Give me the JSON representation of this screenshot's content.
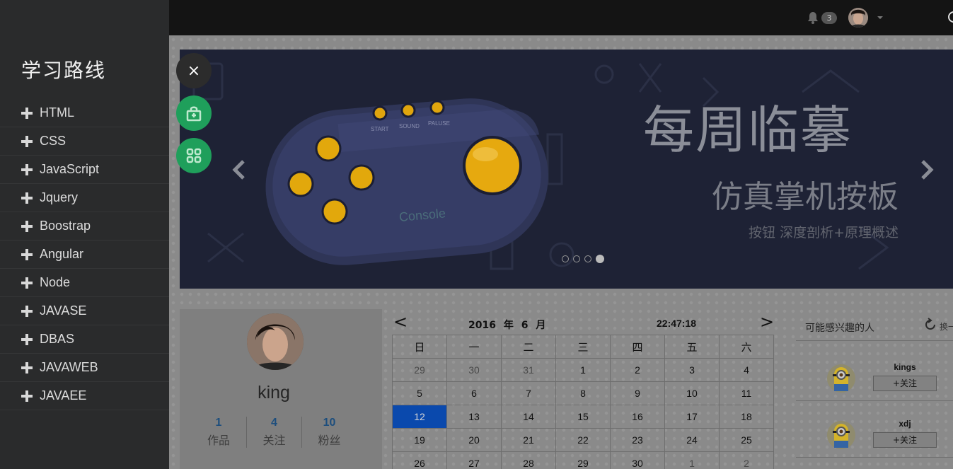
{
  "header": {
    "notification_count": "3",
    "icons": [
      "bell-icon",
      "avatar",
      "chevron-down-icon"
    ]
  },
  "sidebar": {
    "title": "学习路线",
    "items": [
      {
        "label": "HTML"
      },
      {
        "label": "CSS"
      },
      {
        "label": "JavaScript"
      },
      {
        "label": "Jquery"
      },
      {
        "label": "Boostrap"
      },
      {
        "label": "Angular"
      },
      {
        "label": "Node"
      },
      {
        "label": "JAVASE"
      },
      {
        "label": "DBAS"
      },
      {
        "label": "JAVAWEB"
      },
      {
        "label": "JAVAEE"
      }
    ]
  },
  "floating": {
    "close_symbol": "×",
    "icons": [
      "close-icon",
      "lock-icon",
      "grid-icon"
    ]
  },
  "banner": {
    "title": "每周临摹",
    "subtitle": "仿真掌机按板",
    "description": "按钮 深度剖析+原理概述",
    "console_label": "Console",
    "small_buttons": [
      "START",
      "SOUND",
      "PALUSE"
    ],
    "slides": 4,
    "active_slide": 4
  },
  "profile": {
    "name": "king",
    "stats": [
      {
        "num": "1",
        "label": "作品"
      },
      {
        "num": "4",
        "label": "关注"
      },
      {
        "num": "10",
        "label": "粉丝"
      }
    ]
  },
  "calendar": {
    "prev": "<",
    "next": ">",
    "year_month": "2016 年 6 月",
    "time": "22:47:18",
    "weekdays": [
      "日",
      "一",
      "二",
      "三",
      "四",
      "五",
      "六"
    ],
    "weeks": [
      [
        [
          "29",
          "muted"
        ],
        [
          "30",
          "muted"
        ],
        [
          "31",
          "muted"
        ],
        [
          "1",
          ""
        ],
        [
          "2",
          ""
        ],
        [
          "3",
          ""
        ],
        [
          "4",
          ""
        ]
      ],
      [
        [
          "5",
          ""
        ],
        [
          "6",
          ""
        ],
        [
          "7",
          ""
        ],
        [
          "8",
          ""
        ],
        [
          "9",
          ""
        ],
        [
          "10",
          ""
        ],
        [
          "11",
          ""
        ]
      ],
      [
        [
          "12",
          "today"
        ],
        [
          "13",
          ""
        ],
        [
          "14",
          ""
        ],
        [
          "15",
          ""
        ],
        [
          "16",
          ""
        ],
        [
          "17",
          ""
        ],
        [
          "18",
          ""
        ]
      ],
      [
        [
          "19",
          ""
        ],
        [
          "20",
          ""
        ],
        [
          "21",
          ""
        ],
        [
          "22",
          ""
        ],
        [
          "23",
          ""
        ],
        [
          "24",
          ""
        ],
        [
          "25",
          ""
        ]
      ],
      [
        [
          "26",
          ""
        ],
        [
          "27",
          ""
        ],
        [
          "28",
          ""
        ],
        [
          "29",
          ""
        ],
        [
          "30",
          ""
        ],
        [
          "1",
          "muted"
        ],
        [
          "2",
          "muted"
        ]
      ]
    ]
  },
  "people": {
    "title": "可能感兴趣的人",
    "refresh_label": "换一",
    "list": [
      {
        "name": "kings",
        "follow": "+关注"
      },
      {
        "name": "xdj",
        "follow": "+关注"
      }
    ]
  },
  "colors": {
    "sidebar_bg": "#2a2b2c",
    "topbar_bg": "#141414",
    "accent_green": "#1f9f5b",
    "today_blue": "#0a49ad",
    "stat_blue": "#1d4e7d"
  }
}
